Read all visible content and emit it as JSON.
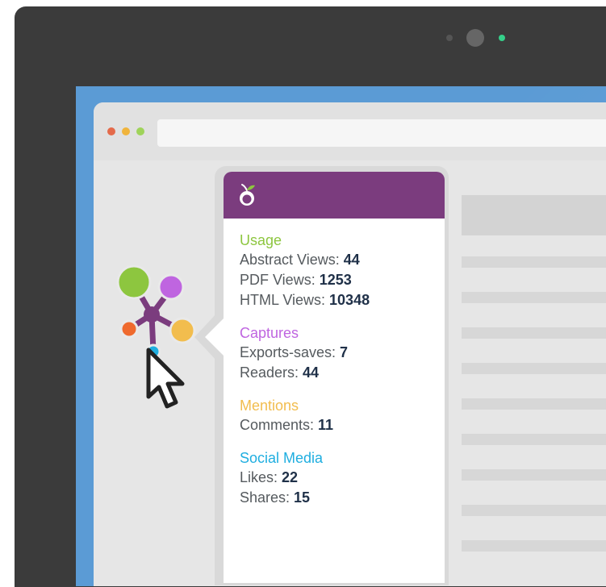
{
  "popup": {
    "sections": [
      {
        "title": "Usage",
        "color": "#8dc63f",
        "rows": [
          {
            "label": "Abstract Views: ",
            "value": "44"
          },
          {
            "label": "PDF Views: ",
            "value": "1253"
          },
          {
            "label": "HTML Views: ",
            "value": "10348"
          }
        ]
      },
      {
        "title": "Captures",
        "color": "#bf65e0",
        "rows": [
          {
            "label": "Exports-saves: ",
            "value": "7"
          },
          {
            "label": "Readers: ",
            "value": "44"
          }
        ]
      },
      {
        "title": "Mentions",
        "color": "#f2bd4e",
        "rows": [
          {
            "label": "Comments: ",
            "value": "11"
          }
        ]
      },
      {
        "title": "Social Media",
        "color": "#1faee0",
        "rows": [
          {
            "label": "Likes: ",
            "value": "22"
          },
          {
            "label": "Shares: ",
            "value": "15"
          }
        ]
      }
    ]
  },
  "colors": {
    "popup_header": "#7b3c7e",
    "screen_frame": "#5b9bd5",
    "monitor": "#3b3b3b"
  },
  "icons": {
    "logo": "plum-logo-icon",
    "badge": "plumx-badge-icon",
    "cursor": "cursor-arrow-icon"
  }
}
